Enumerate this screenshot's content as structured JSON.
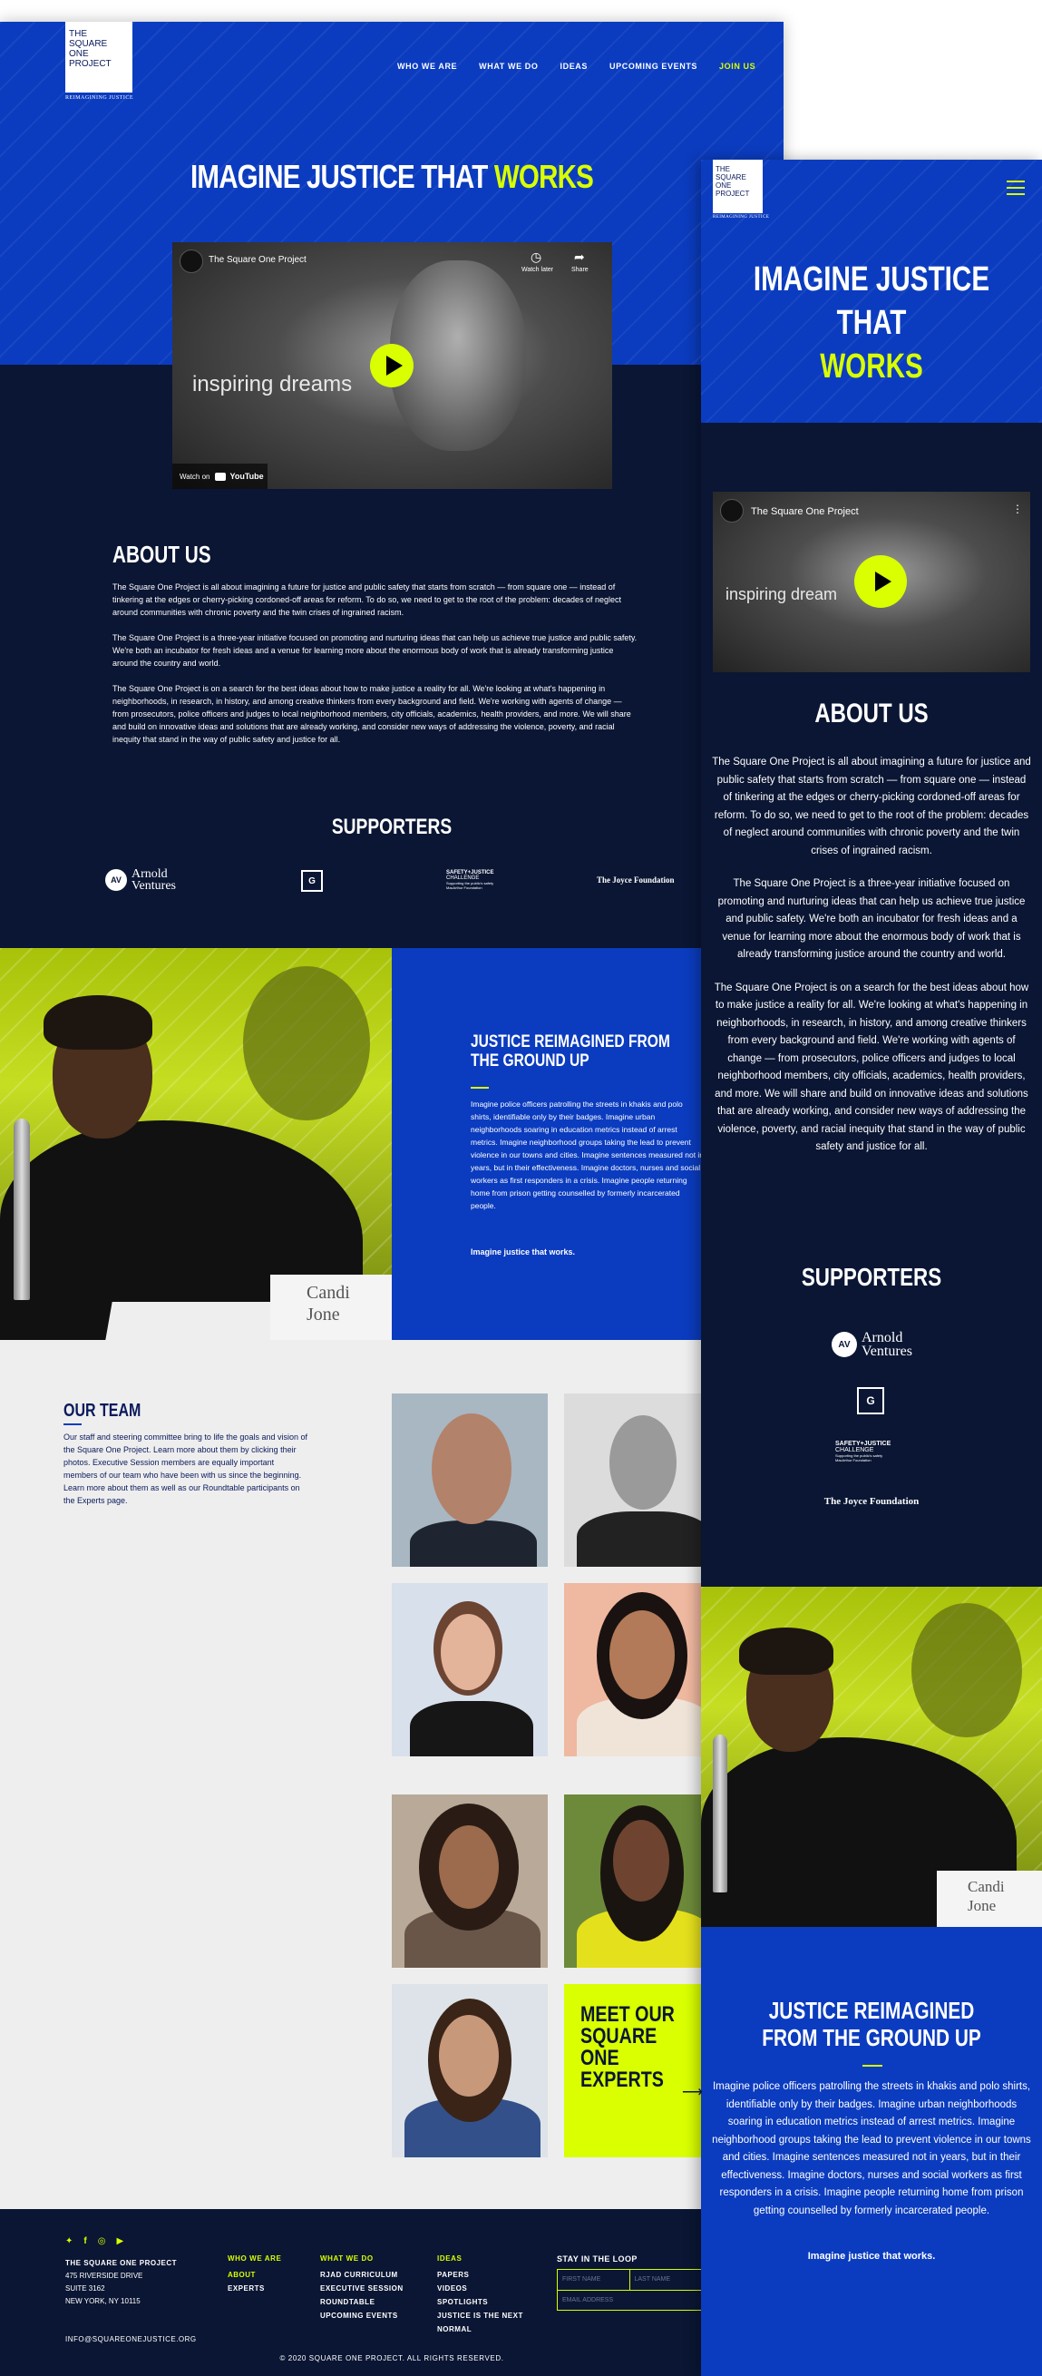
{
  "desktop": {
    "logo": {
      "line1": "THE",
      "line2": "SQUARE ONE",
      "line3": "PROJECT",
      "tagline": "REIMAGINING JUSTICE"
    },
    "nav": [
      {
        "label": "WHO WE ARE"
      },
      {
        "label": "WHAT WE DO"
      },
      {
        "label": "IDEAS"
      },
      {
        "label": "UPCOMING EVENTS"
      },
      {
        "label": "JOIN US"
      }
    ],
    "hero": {
      "title_main": "IMAGINE JUSTICE THAT ",
      "title_accent": "WORKS"
    },
    "video": {
      "channel_title": "The Square One Project",
      "overlay_text": "inspiring dreams",
      "watch_later": "Watch later",
      "share": "Share",
      "watch_on": "Watch on",
      "youtube": "YouTube"
    },
    "about": {
      "heading": "ABOUT US",
      "p1": "The Square One Project is all about imagining a future for justice and public safety that starts from scratch — from square one — instead of tinkering at the edges or cherry-picking cordoned-off areas for reform. To do so, we need to get to the root of the problem: decades of neglect around communities with chronic poverty and the twin crises of ingrained racism.",
      "p2": "The Square One Project is a three-year initiative focused on promoting and nurturing ideas that  can help us achieve true justice and public safety. We're both an incubator for fresh ideas and a venue for learning more about the enormous body of work that is already transforming justice around the country and world.",
      "p3": "The Square One Project is on a search for the best ideas about how to make justice a reality for all.  We're looking at what's happening in neighborhoods, in research, in history, and among creative thinkers from every background and field.  We're working with agents of change — from prosecutors, police officers and judges to local neighborhood members, city officials, academics, health providers, and more. We will share and build on innovative ideas and solutions that are already working, and consider new ways of addressing the violence, poverty, and racial inequity that stand in the way of public safety and justice for all."
    },
    "supporters": {
      "heading": "SUPPORTERS",
      "arnold_line1": "Arnold",
      "arnold_line2": "Ventures",
      "sj_line1": "SAFETY+JUSTICE",
      "sj_line2": "CHALLENGE",
      "sj_line3": "Supporting the public's safety",
      "sj_line4": "MacArthur Foundation",
      "joyce": "The Joyce Foundation"
    },
    "reimagined": {
      "heading": "JUSTICE REIMAGINED FROM THE GROUND UP",
      "body": "Imagine police officers patrolling the streets in khakis and polo shirts, identifiable only by their badges. Imagine urban neighborhoods soaring in education metrics instead of arrest metrics. Imagine neighborhood groups taking the lead to prevent violence in our towns and cities. Imagine sentences measured not in years, but in their effectiveness. Imagine doctors, nurses and social workers as first responders in a crisis. Imagine people returning home from prison getting counselled by formerly incarcerated people.",
      "closing": "Imagine justice that works.",
      "nameplate1": "Candi",
      "nameplate2": "Jone"
    },
    "team": {
      "heading": "OUR TEAM",
      "body": "Our staff and steering committee bring to life the goals and vision of the Square One Project. Learn more about them by clicking their photos. Executive Session members are equally important members of our team who have been with us since the beginning. Learn more about them as well as our Roundtable participants on the Experts page.",
      "experts_cta": "MEET OUR SQUARE ONE EXPERTS"
    },
    "footer": {
      "org_name": "THE SQUARE ONE PROJECT",
      "addr1": "475 RIVERSIDE DRIVE",
      "addr2": "SUITE 3162",
      "addr3": "NEW YORK, NY 10115",
      "email": "INFO@SQUAREONEJUSTICE.ORG",
      "col1_head": "WHO WE ARE",
      "col1_items": [
        "ABOUT",
        "EXPERTS"
      ],
      "col2_head": "WHAT WE DO",
      "col2_items": [
        "RJAD CURRICULUM",
        "EXECUTIVE SESSION",
        "ROUNDTABLE",
        "UPCOMING EVENTS"
      ],
      "col3_head": "IDEAS",
      "col3_items": [
        "PAPERS",
        "VIDEOS",
        "SPOTLIGHTS",
        "JUSTICE IS THE NEXT NORMAL"
      ],
      "newsletter_head": "STAY IN THE LOOP",
      "first_name_ph": "FIRST NAME",
      "last_name_ph": "LAST NAME",
      "email_ph": "EMAIL ADDRESS",
      "copyright": "© 2020 SQUARE ONE PROJECT. ALL RIGHTS RESERVED."
    }
  },
  "mobile": {
    "logo": {
      "line1": "THE",
      "line2": "SQUARE ONE",
      "line3": "PROJECT",
      "tagline": "REIMAGINING JUSTICE"
    },
    "hero": {
      "title_line1": "IMAGINE JUSTICE THAT",
      "title_accent": "WORKS"
    },
    "video": {
      "channel_title": "The Square One Project",
      "overlay_text": "inspiring dream"
    },
    "about": {
      "heading": "ABOUT US",
      "p1": "The Square One Project is all about imagining a future for justice and public safety that starts from scratch — from square one — instead of tinkering at the edges or cherry-picking cordoned-off areas for reform. To do so, we need to get to the root of the problem: decades of neglect around communities with chronic poverty and the twin crises of ingrained racism.",
      "p2": "The Square One Project is a three-year initiative focused on promoting and nurturing ideas that  can help us achieve true justice and public safety. We're both an incubator for fresh ideas and a venue for learning more about the enormous body of work that is already transforming justice around the country and world.",
      "p3": "The Square One Project is on a search for the best ideas about how to make justice a reality for all.  We're looking at what's happening in neighborhoods, in research, in history, and among creative thinkers from every background and field.  We're working with agents of change — from prosecutors, police officers and judges to local neighborhood members, city officials, academics, health providers, and more. We will share and build on innovative ideas and solutions that are already working, and consider new ways of addressing the violence, poverty, and racial inequity that stand in the way of public safety and justice for all."
    },
    "supporters": {
      "heading": "SUPPORTERS"
    },
    "reimagined": {
      "heading": "JUSTICE REIMAGINED FROM THE GROUND UP",
      "body": "Imagine police officers patrolling the streets in khakis and polo shirts, identifiable only by their badges. Imagine urban neighborhoods soaring in education metrics instead of arrest metrics. Imagine neighborhood groups taking the lead to prevent violence in our towns and cities. Imagine sentences measured not in years, but in their effectiveness. Imagine doctors, nurses and social workers as first responders in a crisis. Imagine people returning home from prison getting counselled by formerly incarcerated people.",
      "closing": "Imagine justice that works."
    }
  },
  "colors": {
    "blue": "#0b3cbf",
    "navy": "#0a1633",
    "lime": "#d9ff00",
    "light_gray": "#eeeeee"
  }
}
